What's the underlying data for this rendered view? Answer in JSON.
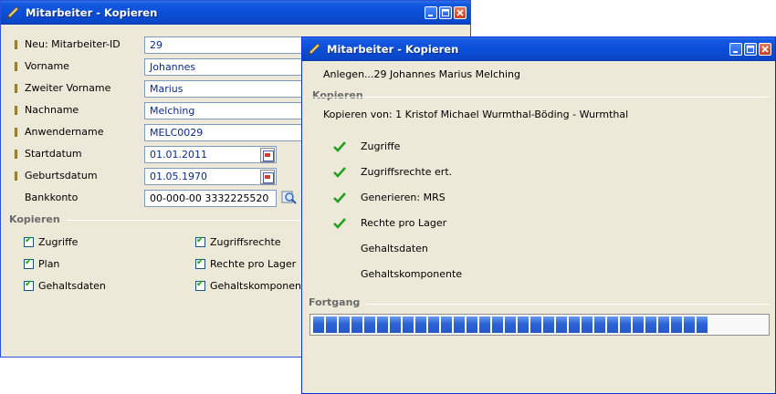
{
  "back_window": {
    "title": "Mitarbeiter - Kopieren",
    "fields": [
      {
        "label": "Neu: Mitarbeiter-ID",
        "value": "29",
        "required": true
      },
      {
        "label": "Vorname",
        "value": "Johannes",
        "required": true
      },
      {
        "label": "Zweiter Vorname",
        "value": "Marius",
        "required": true
      },
      {
        "label": "Nachname",
        "value": "Melching",
        "required": true
      },
      {
        "label": "Anwendername",
        "value": "MELC0029",
        "required": true
      },
      {
        "label": "Startdatum",
        "value": "01.01.2011",
        "required": true
      },
      {
        "label": "Geburtsdatum",
        "value": "01.05.1970",
        "required": true
      },
      {
        "label": "Bankkonto",
        "value": "00-000-00 3332225520",
        "required": false
      }
    ],
    "group_title": "Kopieren",
    "checkboxes": [
      {
        "label": "Zugriffe",
        "checked": true
      },
      {
        "label": "Zugriffsrechte",
        "checked": true
      },
      {
        "label": "Plan",
        "checked": true
      },
      {
        "label": "Rechte pro Lager",
        "checked": true
      },
      {
        "label": "Gehaltsdaten",
        "checked": true
      },
      {
        "label": "Gehaltskomponen",
        "checked": true
      }
    ]
  },
  "front_window": {
    "title": "Mitarbeiter - Kopieren",
    "status_line": "Anlegen...29 Johannes Marius Melching",
    "copy_group_title": "Kopieren",
    "copy_from": "Kopieren von: 1 Kristof Michael Wurmthal-Böding - Wurmthal",
    "steps": [
      {
        "label": "Zugriffe",
        "done": true
      },
      {
        "label": "Zugriffsrechte ert.",
        "done": true
      },
      {
        "label": "Generieren: MRS",
        "done": true
      },
      {
        "label": "Rechte pro Lager",
        "done": true
      },
      {
        "label": "Gehaltsdaten",
        "done": false
      },
      {
        "label": "Gehaltskomponente",
        "done": false
      }
    ],
    "progress_group_title": "Fortgang",
    "progress_fraction": 0.86
  },
  "colors": {
    "titlebar": "#0a4fd8",
    "window_bg": "#ece9d8",
    "field_text": "#0a2a8c",
    "check_green": "#21a121",
    "progress_blue": "#2b63d5"
  },
  "icons": {
    "app": "pen-icon",
    "calendar": "calendar-icon",
    "lookup": "lookup-icon",
    "check": "checkmark-icon"
  }
}
